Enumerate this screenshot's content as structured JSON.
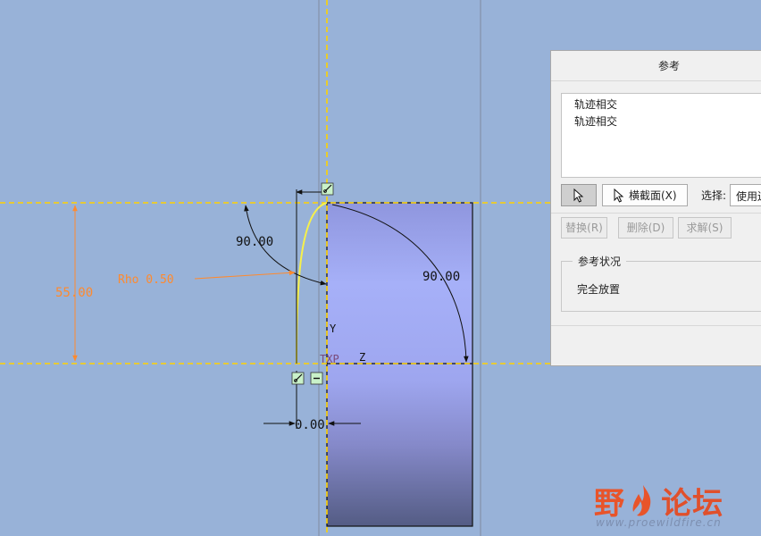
{
  "sketch": {
    "dim_left_angle": "90.00",
    "dim_right_angle": "90.00",
    "dim_height": "55.00",
    "dim_rho": "Rho 0.50",
    "dim_bottom": "0.00",
    "axis_y": "Y",
    "axis_z": "Z",
    "csys_label": "TXP"
  },
  "dialog": {
    "title": "参考",
    "references": [
      "轨迹相交",
      "轨迹相交"
    ],
    "xsection_button": "横截面(X)",
    "select_label": "选择:",
    "select_value": "使用边",
    "replace_button": "替换(R)",
    "delete_button": "删除(D)",
    "solve_button": "求解(S)",
    "status_legend": "参考状况",
    "status_text": "完全放置"
  },
  "watermark": {
    "cn_prefix": "野",
    "cn_suffix": "论坛",
    "url": "www.proewildfire.cn"
  },
  "colors": {
    "background": "#98b2d8",
    "reference_line": "#ffd200",
    "dimension_orange": "#ff8a2e",
    "curve_yellow": "#f6f04a",
    "watermark_red": "#e8542a"
  }
}
